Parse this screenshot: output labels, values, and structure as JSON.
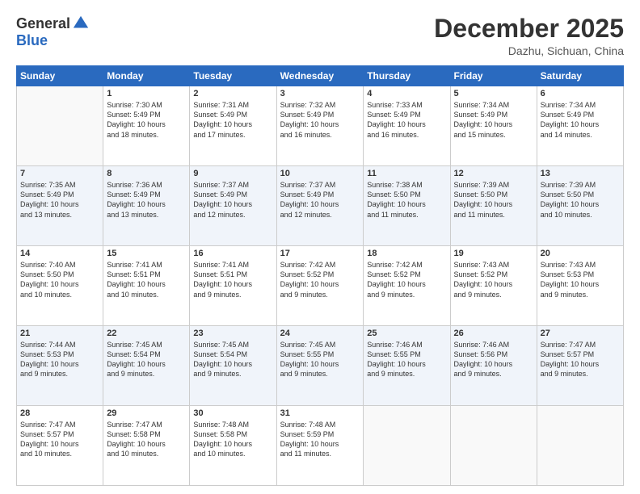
{
  "logo": {
    "general": "General",
    "blue": "Blue"
  },
  "title": "December 2025",
  "location": "Dazhu, Sichuan, China",
  "days_of_week": [
    "Sunday",
    "Monday",
    "Tuesday",
    "Wednesday",
    "Thursday",
    "Friday",
    "Saturday"
  ],
  "weeks": [
    [
      {
        "day": "",
        "info": ""
      },
      {
        "day": "1",
        "info": "Sunrise: 7:30 AM\nSunset: 5:49 PM\nDaylight: 10 hours\nand 18 minutes."
      },
      {
        "day": "2",
        "info": "Sunrise: 7:31 AM\nSunset: 5:49 PM\nDaylight: 10 hours\nand 17 minutes."
      },
      {
        "day": "3",
        "info": "Sunrise: 7:32 AM\nSunset: 5:49 PM\nDaylight: 10 hours\nand 16 minutes."
      },
      {
        "day": "4",
        "info": "Sunrise: 7:33 AM\nSunset: 5:49 PM\nDaylight: 10 hours\nand 16 minutes."
      },
      {
        "day": "5",
        "info": "Sunrise: 7:34 AM\nSunset: 5:49 PM\nDaylight: 10 hours\nand 15 minutes."
      },
      {
        "day": "6",
        "info": "Sunrise: 7:34 AM\nSunset: 5:49 PM\nDaylight: 10 hours\nand 14 minutes."
      }
    ],
    [
      {
        "day": "7",
        "info": "Sunrise: 7:35 AM\nSunset: 5:49 PM\nDaylight: 10 hours\nand 13 minutes."
      },
      {
        "day": "8",
        "info": "Sunrise: 7:36 AM\nSunset: 5:49 PM\nDaylight: 10 hours\nand 13 minutes."
      },
      {
        "day": "9",
        "info": "Sunrise: 7:37 AM\nSunset: 5:49 PM\nDaylight: 10 hours\nand 12 minutes."
      },
      {
        "day": "10",
        "info": "Sunrise: 7:37 AM\nSunset: 5:49 PM\nDaylight: 10 hours\nand 12 minutes."
      },
      {
        "day": "11",
        "info": "Sunrise: 7:38 AM\nSunset: 5:50 PM\nDaylight: 10 hours\nand 11 minutes."
      },
      {
        "day": "12",
        "info": "Sunrise: 7:39 AM\nSunset: 5:50 PM\nDaylight: 10 hours\nand 11 minutes."
      },
      {
        "day": "13",
        "info": "Sunrise: 7:39 AM\nSunset: 5:50 PM\nDaylight: 10 hours\nand 10 minutes."
      }
    ],
    [
      {
        "day": "14",
        "info": "Sunrise: 7:40 AM\nSunset: 5:50 PM\nDaylight: 10 hours\nand 10 minutes."
      },
      {
        "day": "15",
        "info": "Sunrise: 7:41 AM\nSunset: 5:51 PM\nDaylight: 10 hours\nand 10 minutes."
      },
      {
        "day": "16",
        "info": "Sunrise: 7:41 AM\nSunset: 5:51 PM\nDaylight: 10 hours\nand 9 minutes."
      },
      {
        "day": "17",
        "info": "Sunrise: 7:42 AM\nSunset: 5:52 PM\nDaylight: 10 hours\nand 9 minutes."
      },
      {
        "day": "18",
        "info": "Sunrise: 7:42 AM\nSunset: 5:52 PM\nDaylight: 10 hours\nand 9 minutes."
      },
      {
        "day": "19",
        "info": "Sunrise: 7:43 AM\nSunset: 5:52 PM\nDaylight: 10 hours\nand 9 minutes."
      },
      {
        "day": "20",
        "info": "Sunrise: 7:43 AM\nSunset: 5:53 PM\nDaylight: 10 hours\nand 9 minutes."
      }
    ],
    [
      {
        "day": "21",
        "info": "Sunrise: 7:44 AM\nSunset: 5:53 PM\nDaylight: 10 hours\nand 9 minutes."
      },
      {
        "day": "22",
        "info": "Sunrise: 7:45 AM\nSunset: 5:54 PM\nDaylight: 10 hours\nand 9 minutes."
      },
      {
        "day": "23",
        "info": "Sunrise: 7:45 AM\nSunset: 5:54 PM\nDaylight: 10 hours\nand 9 minutes."
      },
      {
        "day": "24",
        "info": "Sunrise: 7:45 AM\nSunset: 5:55 PM\nDaylight: 10 hours\nand 9 minutes."
      },
      {
        "day": "25",
        "info": "Sunrise: 7:46 AM\nSunset: 5:55 PM\nDaylight: 10 hours\nand 9 minutes."
      },
      {
        "day": "26",
        "info": "Sunrise: 7:46 AM\nSunset: 5:56 PM\nDaylight: 10 hours\nand 9 minutes."
      },
      {
        "day": "27",
        "info": "Sunrise: 7:47 AM\nSunset: 5:57 PM\nDaylight: 10 hours\nand 9 minutes."
      }
    ],
    [
      {
        "day": "28",
        "info": "Sunrise: 7:47 AM\nSunset: 5:57 PM\nDaylight: 10 hours\nand 10 minutes."
      },
      {
        "day": "29",
        "info": "Sunrise: 7:47 AM\nSunset: 5:58 PM\nDaylight: 10 hours\nand 10 minutes."
      },
      {
        "day": "30",
        "info": "Sunrise: 7:48 AM\nSunset: 5:58 PM\nDaylight: 10 hours\nand 10 minutes."
      },
      {
        "day": "31",
        "info": "Sunrise: 7:48 AM\nSunset: 5:59 PM\nDaylight: 10 hours\nand 11 minutes."
      },
      {
        "day": "",
        "info": ""
      },
      {
        "day": "",
        "info": ""
      },
      {
        "day": "",
        "info": ""
      }
    ]
  ]
}
